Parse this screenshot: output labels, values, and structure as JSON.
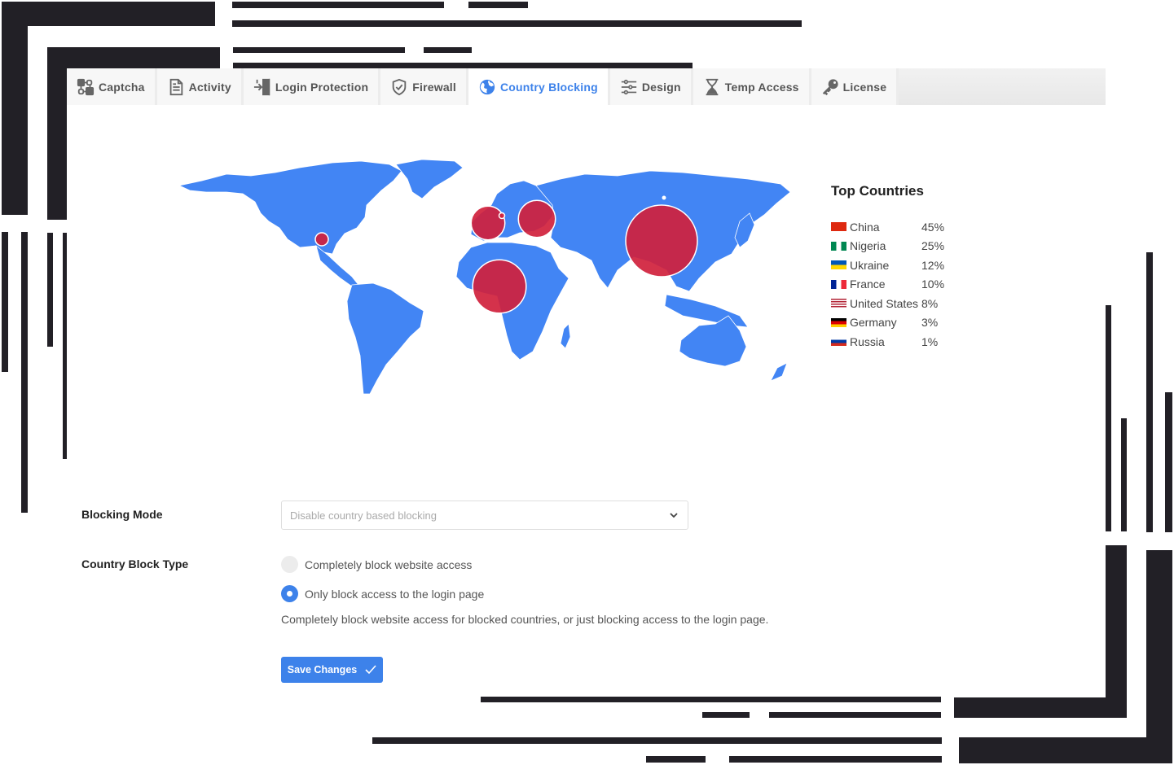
{
  "tabs": [
    {
      "label": "Captcha",
      "icon": "captcha-icon",
      "active": false
    },
    {
      "label": "Activity",
      "icon": "document-icon",
      "active": false
    },
    {
      "label": "Login Protection",
      "icon": "login-door-icon",
      "active": false
    },
    {
      "label": "Firewall",
      "icon": "shield-check-icon",
      "active": false
    },
    {
      "label": "Country Blocking",
      "icon": "globe-icon",
      "active": true
    },
    {
      "label": "Design",
      "icon": "sliders-icon",
      "active": false
    },
    {
      "label": "Temp Access",
      "icon": "hourglass-icon",
      "active": false
    },
    {
      "label": "License",
      "icon": "key-icon",
      "active": false
    }
  ],
  "colors": {
    "accent": "#3d82ea",
    "map_land": "#4285f4",
    "bubble": "#d0213c",
    "decoration": "#222026"
  },
  "chart_data": {
    "type": "bubble-map",
    "title": "Top Countries",
    "series": [
      {
        "country": "China",
        "percent": 45,
        "flag": [
          "#de2910",
          "#de2910",
          "#ffde00"
        ]
      },
      {
        "country": "Nigeria",
        "percent": 25,
        "flag": [
          "#008751",
          "#ffffff",
          "#008751"
        ]
      },
      {
        "country": "Ukraine",
        "percent": 12,
        "flag": [
          "#0057b7",
          "#ffd700"
        ]
      },
      {
        "country": "France",
        "percent": 10,
        "flag": [
          "#002395",
          "#ffffff",
          "#ed2939"
        ]
      },
      {
        "country": "United States",
        "percent": 8,
        "flag": [
          "#b22234",
          "#ffffff",
          "#3c3b6e"
        ]
      },
      {
        "country": "Germany",
        "percent": 3,
        "flag": [
          "#000000",
          "#dd0000",
          "#ffce00"
        ]
      },
      {
        "country": "Russia",
        "percent": 1,
        "flag": [
          "#ffffff",
          "#0039a6",
          "#d52b1e"
        ]
      }
    ]
  },
  "legend": {
    "title": "Top Countries",
    "rows": [
      {
        "country": "China",
        "pct": "45%"
      },
      {
        "country": "Nigeria",
        "pct": "25%"
      },
      {
        "country": "Ukraine",
        "pct": "12%"
      },
      {
        "country": "France",
        "pct": "10%"
      },
      {
        "country": "United States",
        "pct": "8%"
      },
      {
        "country": "Germany",
        "pct": "3%"
      },
      {
        "country": "Russia",
        "pct": "1%"
      }
    ]
  },
  "form": {
    "blocking_mode_label": "Blocking Mode",
    "blocking_mode_value": "Disable country based blocking",
    "block_type_label": "Country Block Type",
    "options": [
      {
        "label": "Completely block website access",
        "selected": false
      },
      {
        "label": "Only block access to the login page",
        "selected": true
      }
    ],
    "help_text": "Completely block website access for blocked countries, or just blocking access to the login page.",
    "save_label": "Save Changes"
  }
}
